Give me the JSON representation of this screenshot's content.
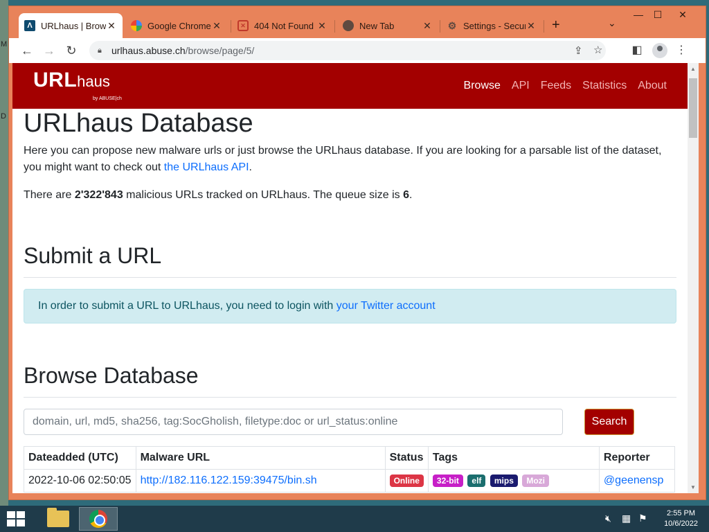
{
  "desktop": {
    "edge_letters": [
      "M",
      "D"
    ]
  },
  "browser": {
    "tabs": [
      {
        "title": "URLhaus | Brows",
        "favicon": "urlhaus-favicon",
        "active": true
      },
      {
        "title": "Google Chrome",
        "favicon": "google-g-icon",
        "active": false
      },
      {
        "title": "404 Not Found",
        "favicon": "error-page-icon",
        "active": false
      },
      {
        "title": "New Tab",
        "favicon": "chrome-icon",
        "active": false
      },
      {
        "title": "Settings - Secur",
        "favicon": "gear-icon",
        "active": false
      }
    ],
    "url_host": "urlhaus.abuse.ch",
    "url_path": "/browse/page/5/"
  },
  "site": {
    "logo_main": "URL",
    "logo_sub": "haus",
    "logo_by": "by ABUSE|ch",
    "nav": [
      {
        "label": "Browse",
        "active": true
      },
      {
        "label": "API",
        "active": false
      },
      {
        "label": "Feeds",
        "active": false
      },
      {
        "label": "Statistics",
        "active": false
      },
      {
        "label": "About",
        "active": false
      }
    ]
  },
  "page": {
    "title": "URLhaus Database",
    "intro": "Here you can propose new malware urls or just browse the URLhaus database. If you are looking for a parsable list of the dataset, you might want to check out ",
    "intro_link": "the URLhaus API",
    "intro_end": ".",
    "stats_prefix": "There are ",
    "stats_count": "2'322'843",
    "stats_mid": " malicious URLs tracked on URLhaus. The queue size is ",
    "stats_queue": "6",
    "stats_end": ".",
    "submit_heading": "Submit a URL",
    "submit_alert": "In order to submit a URL to URLhaus, you need to login with ",
    "submit_alert_link": "your Twitter account",
    "browse_heading": "Browse Database",
    "search_placeholder": "domain, url, md5, sha256, tag:SocGholish, filetype:doc or url_status:online",
    "search_button": "Search",
    "table": {
      "headers": [
        "Dateadded (UTC)",
        "Malware URL",
        "Status",
        "Tags",
        "Reporter"
      ],
      "rows": [
        {
          "date": "2022-10-06 02:50:05",
          "url": "http://182.116.122.159:39475/bin.sh",
          "status": "Online",
          "tags": [
            "32-bit",
            "elf",
            "mips",
            "Mozi"
          ],
          "reporter": "@geenensp"
        }
      ]
    }
  },
  "taskbar": {
    "time": "2:55 PM",
    "date": "10/6/2022"
  },
  "colors": {
    "brand": "#a30000",
    "tab_strip": "#e8835a",
    "status_online": "#dc3545",
    "tag_32bit": "#c71fc7",
    "tag_elf": "#1b6e6e",
    "tag_mips": "#1a1a6e",
    "tag_mozi": "#d8a8d8"
  }
}
